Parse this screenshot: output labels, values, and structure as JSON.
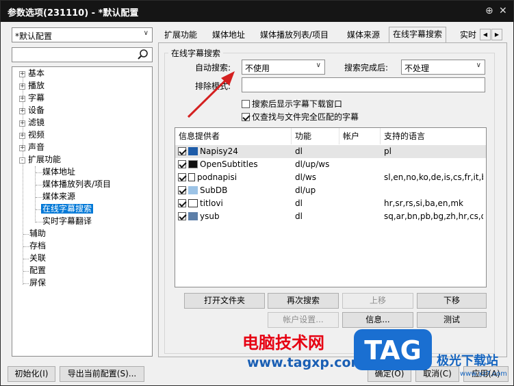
{
  "window": {
    "title": "参数选项(231110) - *默认配置",
    "pin_icon": "pin-icon",
    "close_icon": "close-icon"
  },
  "profile": {
    "value": "*默认配置"
  },
  "search": {
    "value": ""
  },
  "tree": {
    "items": [
      {
        "label": "基本",
        "expand": "+"
      },
      {
        "label": "播放",
        "expand": "+"
      },
      {
        "label": "字幕",
        "expand": "+"
      },
      {
        "label": "设备",
        "expand": "+"
      },
      {
        "label": "滤镜",
        "expand": "+"
      },
      {
        "label": "视频",
        "expand": "+"
      },
      {
        "label": "声音",
        "expand": "+"
      },
      {
        "label": "扩展功能",
        "expand": "-"
      },
      {
        "label": "媒体地址"
      },
      {
        "label": "媒体播放列表/项目"
      },
      {
        "label": "媒体来源"
      },
      {
        "label": "在线字幕搜索"
      },
      {
        "label": "实时字幕翻译"
      },
      {
        "label": "辅助"
      },
      {
        "label": "存档"
      },
      {
        "label": "关联"
      },
      {
        "label": "配置"
      },
      {
        "label": "屏保"
      }
    ]
  },
  "tabs": [
    "扩展功能",
    "媒体地址",
    "媒体播放列表/项目",
    "媒体来源",
    "在线字幕搜索",
    "实时"
  ],
  "group": {
    "title": "在线字幕搜索",
    "auto_search_label": "自动搜索:",
    "auto_search_value": "不使用",
    "after_search_label": "搜索完成后:",
    "after_search_value": "不处理",
    "exclude_label": "排除模式:",
    "exclude_value": "",
    "show_window_label": "搜索后显示字幕下载窗口",
    "match_only_label": "仅查找与文件完全匹配的字幕"
  },
  "providers": {
    "headers": [
      "信息提供者",
      "功能",
      "帐户",
      "支持的语言"
    ],
    "rows": [
      {
        "name": "Napisy24",
        "func": "dl",
        "account": "",
        "langs": "pl"
      },
      {
        "name": "OpenSubtitles",
        "func": "dl/up/ws",
        "account": "",
        "langs": ""
      },
      {
        "name": "podnapisi",
        "func": "dl/ws",
        "account": "",
        "langs": "sl,en,no,ko,de,is,cs,fr,it,b..."
      },
      {
        "name": "SubDB",
        "func": "dl/up",
        "account": "",
        "langs": ""
      },
      {
        "name": "titlovi",
        "func": "dl",
        "account": "",
        "langs": "hr,sr,rs,si,ba,en,mk"
      },
      {
        "name": "ysub",
        "func": "dl",
        "account": "",
        "langs": "sq,ar,bn,pb,bg,zh,hr,cs,d..."
      }
    ]
  },
  "buttons": {
    "open_folder": "打开文件夹",
    "research": "再次搜索",
    "move_up": "上移",
    "move_down": "下移",
    "account_settings": "帐户设置...",
    "info": "信息...",
    "test": "测试",
    "init": "初始化(I)",
    "export": "导出当前配置(S)...",
    "ok": "确定(O)",
    "cancel": "取消(C)",
    "apply": "应用(A)"
  },
  "watermark": {
    "line1": "电脑技术网",
    "line2": "www.tagxp.com",
    "logo": "TAG",
    "line3": "极光下载站",
    "line4": "www.xz7.com"
  },
  "colors": {
    "selection": "#0078d7",
    "titlebar": "#151515",
    "arrow": "#d42020"
  }
}
